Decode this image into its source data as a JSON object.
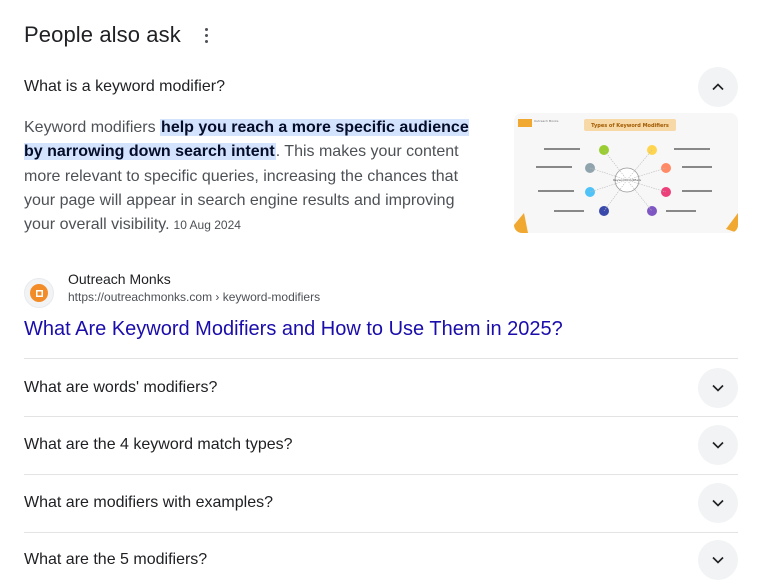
{
  "header": {
    "title": "People also ask",
    "more_icon": "more-vert-icon"
  },
  "expanded": {
    "question": "What is a keyword modifier?",
    "answer_before": "Keyword modifiers ",
    "answer_highlight": "help you reach a more specific audience by narrowing down search intent",
    "answer_after": ". This makes your content more relevant to specific queries, increasing the chances that your page will appear in search engine results and improving your overall visibility.",
    "date": "10 Aug 2024",
    "thumbnail": {
      "title": "Types of Keyword Modifiers",
      "center_label": "Keyword modifiers",
      "logo_text": "Outreach Monks"
    },
    "source": {
      "name": "Outreach Monks",
      "url": "https://outreachmonks.com › keyword-modifiers"
    },
    "link_title": "What Are Keyword Modifiers and How to Use Them in 2025?"
  },
  "questions": [
    {
      "label": "What are words' modifiers?"
    },
    {
      "label": "What are the 4 keyword match types?"
    },
    {
      "label": "What are modifiers with examples?"
    },
    {
      "label": "What are the 5 modifiers?"
    }
  ],
  "colors": {
    "link": "#1a0dab",
    "highlight": "#d3e3fd",
    "chevron_bg": "#f1f3f4"
  }
}
